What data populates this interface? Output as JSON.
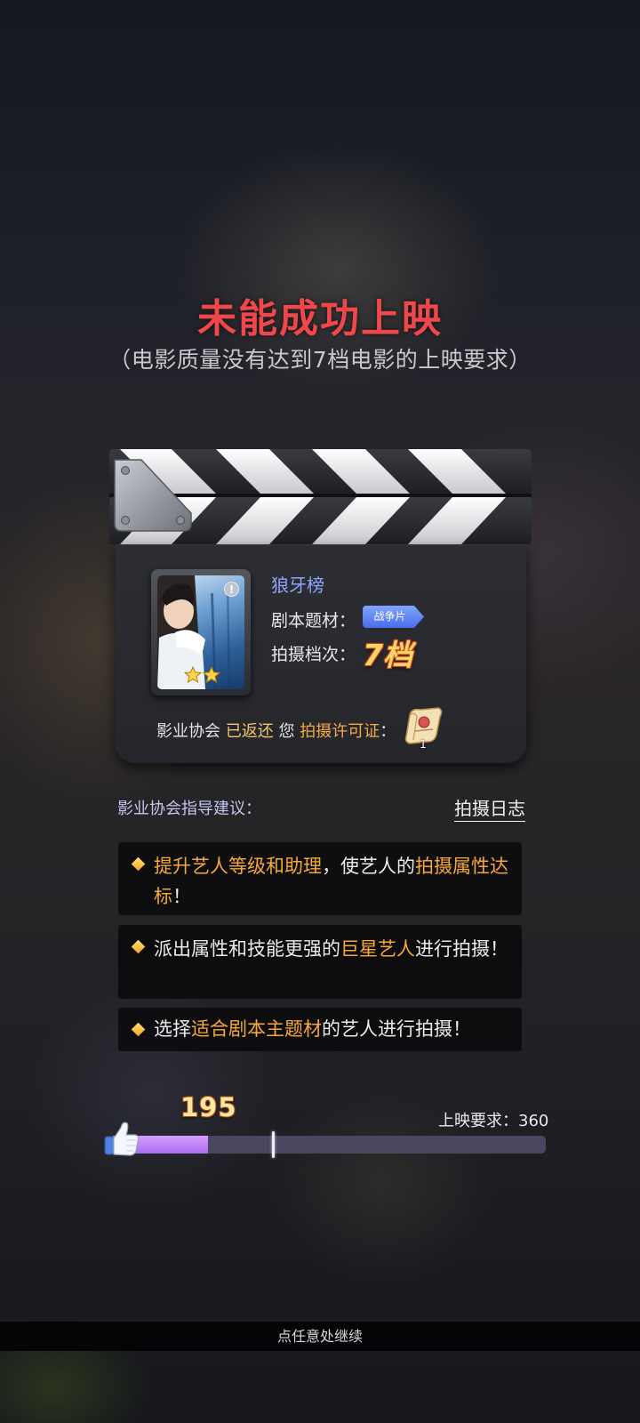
{
  "result": {
    "title": "未能成功上映",
    "subtitle": "（电影质量没有达到7档电影的上映要求）"
  },
  "movie": {
    "name": "狼牙榜",
    "genre_label": "剧本题材：",
    "genre": "战争片",
    "tier_label": "拍摄档次：",
    "tier": "7档",
    "star_rating": 2,
    "info_badge": "!",
    "return_prefix": "影业协会",
    "return_status": "已返还",
    "return_you": "您",
    "permit_name": "拍摄许可证",
    "return_colon": "：",
    "permit_count": "1"
  },
  "advice": {
    "title": "影业协会指导建议：",
    "log_link": "拍摄日志",
    "tips": [
      {
        "before": "",
        "hl1": "提升艺人等级和助理",
        "mid": "，使艺人的",
        "hl2": "拍摄属性达标",
        "after": "！"
      },
      {
        "before": "派出属性和技能更强的",
        "hl1": "巨星艺人",
        "mid": "进行拍摄！",
        "hl2": "",
        "after": ""
      },
      {
        "before": "选择",
        "hl1": "适合剧本主题材",
        "mid": "的艺人进行拍摄！",
        "hl2": "",
        "after": ""
      }
    ]
  },
  "progress": {
    "score": "195",
    "score_value": 195,
    "requirement_label": "上映要求：360",
    "requirement_value": 360,
    "fill_fraction": 0.225,
    "marker_fraction": 0.375
  },
  "footer": {
    "continue_text": "点任意处继续"
  },
  "colors": {
    "title_red": "#f0484a",
    "highlight_orange": "#f6a93a",
    "movie_blue": "#8ca6ff",
    "bar_fill": "#c185fb",
    "bar_track": "#4b4660"
  }
}
